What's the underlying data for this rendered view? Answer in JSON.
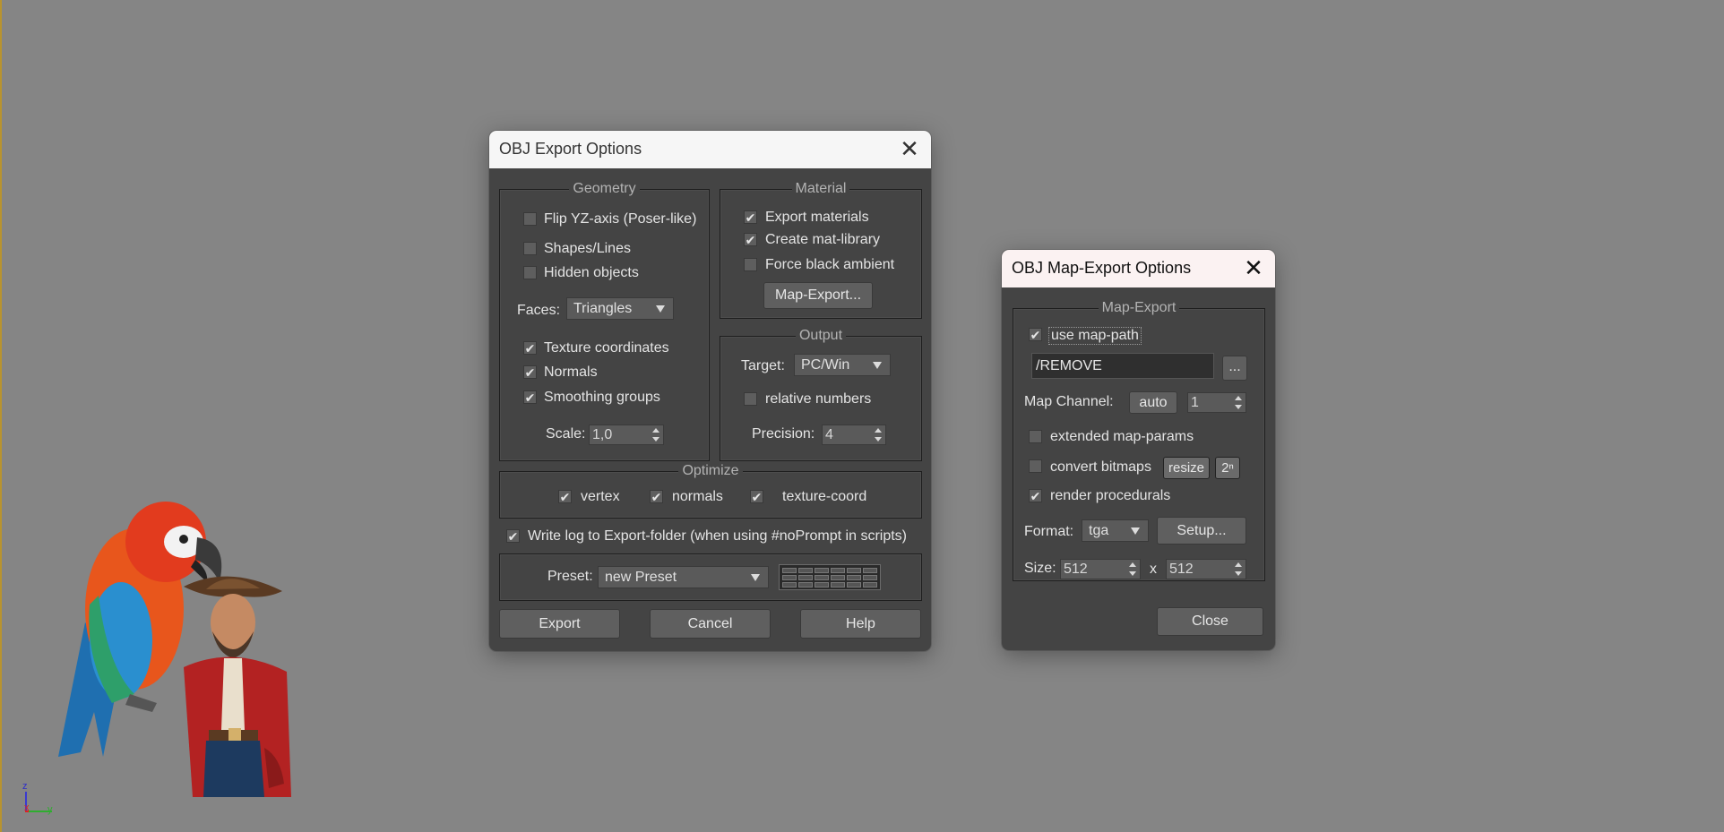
{
  "export_dialog": {
    "title": "OBJ Export Options",
    "close_glyph": "✕",
    "geometry": {
      "legend": "Geometry",
      "flip_yz": {
        "label": "Flip YZ-axis (Poser-like)",
        "checked": false
      },
      "shapes_lines": {
        "label": "Shapes/Lines",
        "checked": false
      },
      "hidden_objects": {
        "label": "Hidden objects",
        "checked": false
      },
      "faces_label": "Faces:",
      "faces_value": "Triangles",
      "texture_coordinates": {
        "label": "Texture coordinates",
        "checked": true
      },
      "normals": {
        "label": "Normals",
        "checked": true
      },
      "smoothing_groups": {
        "label": "Smoothing groups",
        "checked": true
      },
      "scale_label": "Scale:",
      "scale_value": "1,0"
    },
    "material": {
      "legend": "Material",
      "export_materials": {
        "label": "Export materials",
        "checked": true
      },
      "create_mat_library": {
        "label": "Create mat-library",
        "checked": true
      },
      "force_black_ambient": {
        "label": "Force black ambient",
        "checked": false
      },
      "map_export_button": "Map-Export..."
    },
    "output": {
      "legend": "Output",
      "target_label": "Target:",
      "target_value": "PC/Win",
      "relative_numbers": {
        "label": "relative numbers",
        "checked": false
      },
      "precision_label": "Precision:",
      "precision_value": "4"
    },
    "optimize": {
      "legend": "Optimize",
      "vertex": {
        "label": "vertex",
        "checked": true
      },
      "normals": {
        "label": "normals",
        "checked": true
      },
      "texture_coord": {
        "label": "texture-coord",
        "checked": true
      }
    },
    "write_log": {
      "label": "Write log to Export-folder (when using #noPrompt in scripts)",
      "checked": true
    },
    "preset_label": "Preset:",
    "preset_value": "new Preset",
    "buttons": {
      "export": "Export",
      "cancel": "Cancel",
      "help": "Help"
    }
  },
  "map_dialog": {
    "title": "OBJ Map-Export Options",
    "close_glyph": "✕",
    "legend": "Map-Export",
    "use_map_path": {
      "label": "use map-path",
      "checked": true
    },
    "path_value": "/REMOVE",
    "browse_button": "...",
    "map_channel_label": "Map Channel:",
    "auto_button": "auto",
    "channel_value": "1",
    "extended_map_params": {
      "label": "extended map-params",
      "checked": false
    },
    "convert_bitmaps": {
      "label": "convert bitmaps",
      "checked": false
    },
    "resize_button": "resize",
    "power2_button": "2ⁿ",
    "render_procedurals": {
      "label": "render procedurals",
      "checked": true
    },
    "format_label": "Format:",
    "format_value": "tga",
    "setup_button": "Setup...",
    "size_label": "Size:",
    "size_width": "512",
    "size_x": "x",
    "size_height": "512",
    "close_button": "Close"
  },
  "viewport": {
    "axis_z": "z",
    "axis_x": "x",
    "axis_y": "y"
  },
  "check_glyph": "✔"
}
